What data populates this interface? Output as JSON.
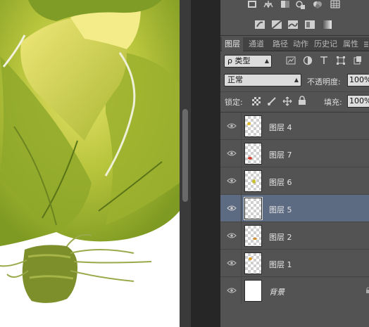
{
  "canvas": {
    "description_icon": "lettuce-painting"
  },
  "panel_tabs": [
    {
      "label": "图层",
      "active": true
    },
    {
      "label": "通道",
      "active": false
    },
    {
      "label": "路径",
      "active": false
    },
    {
      "label": "动作",
      "active": false
    },
    {
      "label": "历史记",
      "active": false
    },
    {
      "label": "属性",
      "active": false
    }
  ],
  "filter": {
    "kind_label": "ρ 类型",
    "icons": [
      "pixel-filter-icon",
      "adjustment-filter-icon",
      "type-filter-icon",
      "shape-filter-icon",
      "smart-object-filter-icon"
    ]
  },
  "blend": {
    "mode": "正常",
    "opacity_label": "不透明度:",
    "opacity_value": "100%"
  },
  "lock": {
    "label": "锁定:",
    "fill_label": "填充:",
    "fill_value": "100%"
  },
  "layers": [
    {
      "name": "图层 4",
      "selected": false,
      "thumb": "transparent",
      "mark": "#e0b820"
    },
    {
      "name": "图层 7",
      "selected": false,
      "thumb": "transparent",
      "mark": "#d04030"
    },
    {
      "name": "图层 6",
      "selected": false,
      "thumb": "transparent",
      "mark": "#c8c030"
    },
    {
      "name": "图层 5",
      "selected": true,
      "thumb": "transparent",
      "mark": ""
    },
    {
      "name": "图层 2",
      "selected": false,
      "thumb": "transparent",
      "mark": "#d09030"
    },
    {
      "name": "图层 1",
      "selected": false,
      "thumb": "transparent",
      "mark": "#e0a020"
    },
    {
      "name": "背景",
      "selected": false,
      "thumb": "white",
      "mark": ""
    }
  ],
  "colors": {
    "panel_bg": "#535353",
    "selected_row": "#5c6a82",
    "canvas_bg": "#ffffff"
  }
}
